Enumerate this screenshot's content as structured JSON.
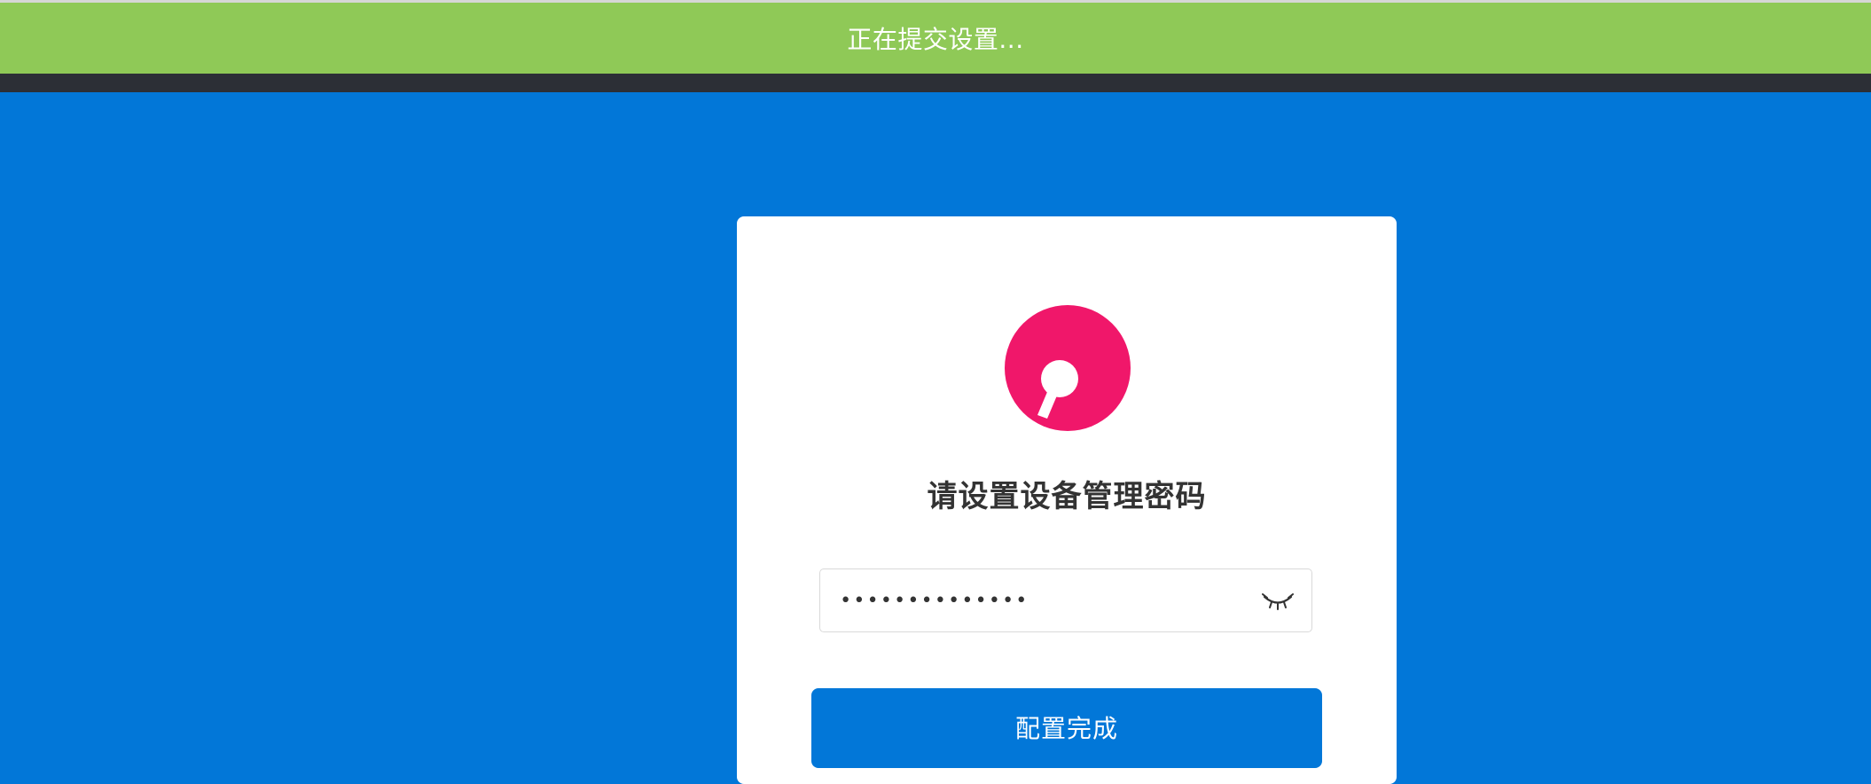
{
  "toast": {
    "message": "正在提交设置..."
  },
  "card": {
    "logo_icon": "brand-logo-icon",
    "title": "请设置设备管理密码",
    "password": {
      "value": "••••••••••••••",
      "toggle_icon": "eye-closed-icon"
    },
    "submit_label": "配置完成"
  },
  "colors": {
    "toast_bg": "#8fc957",
    "page_bg": "#0277d8",
    "logo": "#f0176a",
    "button_bg": "#0277d8"
  }
}
